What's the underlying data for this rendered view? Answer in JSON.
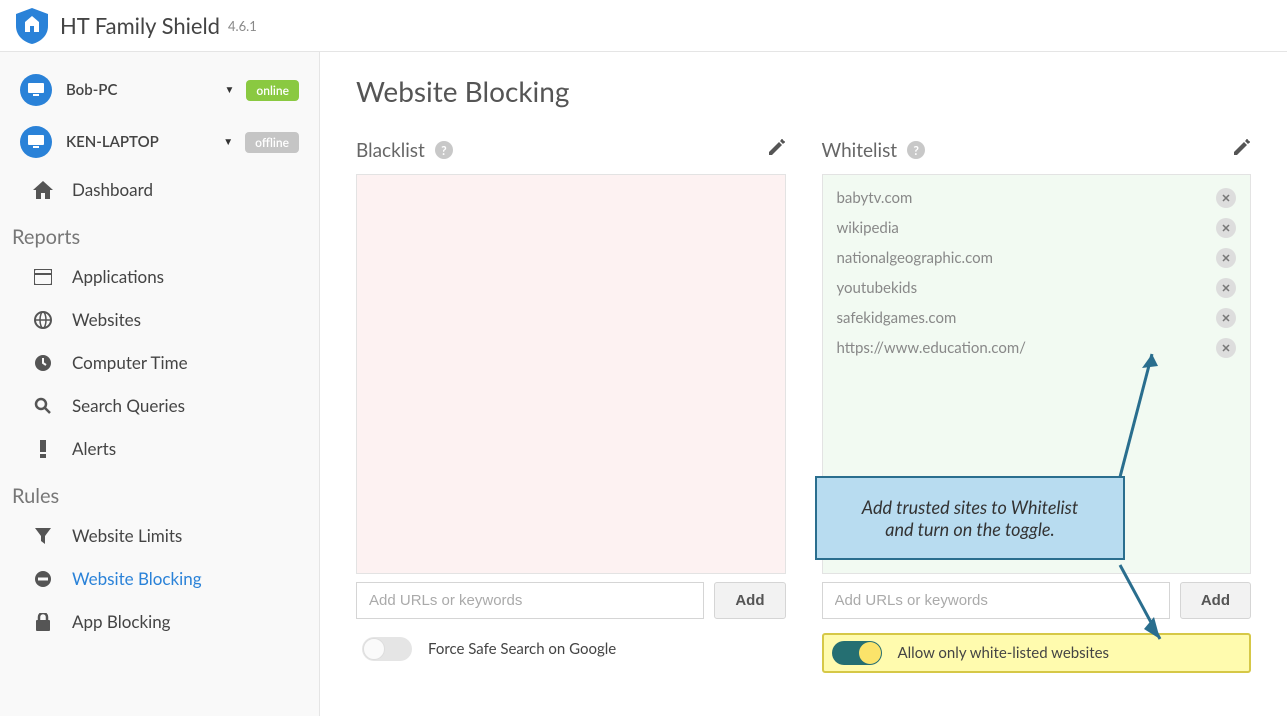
{
  "header": {
    "title": "HT Family Shield",
    "version": "4.6.1"
  },
  "devices": [
    {
      "name": "Bob-PC",
      "status": "online"
    },
    {
      "name": "KEN-LAPTOP",
      "status": "offline"
    }
  ],
  "nav": {
    "dashboard": "Dashboard",
    "reports_label": "Reports",
    "applications": "Applications",
    "websites": "Websites",
    "computer_time": "Computer Time",
    "search_queries": "Search Queries",
    "alerts": "Alerts",
    "rules_label": "Rules",
    "website_limits": "Website Limits",
    "website_blocking": "Website Blocking",
    "app_blocking": "App Blocking"
  },
  "page": {
    "title": "Website Blocking"
  },
  "blacklist": {
    "title": "Blacklist",
    "items": [],
    "placeholder": "Add URLs or keywords",
    "add": "Add",
    "toggle_label": "Force Safe Search on Google",
    "toggle_on": false
  },
  "whitelist": {
    "title": "Whitelist",
    "items": [
      "babytv.com",
      "wikipedia",
      "nationalgeographic.com",
      "youtubekids",
      "safekidgames.com",
      "https://www.education.com/"
    ],
    "placeholder": "Add URLs or keywords",
    "add": "Add",
    "toggle_label": "Allow only white-listed websites",
    "toggle_on": true
  },
  "callout": {
    "line1": "Add trusted sites to Whitelist",
    "line2": "and turn on the toggle."
  }
}
